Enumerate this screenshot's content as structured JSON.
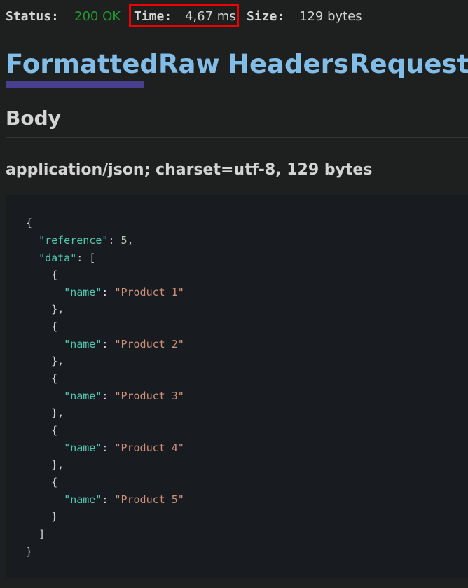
{
  "status_bar": {
    "status_label": "Status:",
    "status_value": "200 OK",
    "time_label": "Time:",
    "time_value": "4,67 ms",
    "size_label": "Size:",
    "size_value": "129 bytes"
  },
  "tabs": [
    {
      "label": "Formatted",
      "active": true
    },
    {
      "label": "Raw",
      "active": false
    },
    {
      "label": "Headers",
      "active": false
    },
    {
      "label": "Request",
      "active": false
    }
  ],
  "section": {
    "heading": "Body",
    "content_type": "application/json; charset=utf-8, 129 bytes"
  },
  "code": {
    "open_brace": "{",
    "reference_key": "\"reference\"",
    "reference_value": "5",
    "data_key": "\"data\"",
    "name_key": "\"name\"",
    "items": [
      "\"Product 1\"",
      "\"Product 2\"",
      "\"Product 3\"",
      "\"Product 4\"",
      "\"Product 5\""
    ],
    "close_bracket": "]",
    "close_brace": "}"
  },
  "colors": {
    "accent_tab": "#82bde8",
    "tab_underline": "#483f8f",
    "status_ok": "#1f9d2e",
    "highlight_box": "#f00000",
    "json_key": "#4ec9b0",
    "json_string": "#ce9178",
    "json_number": "#b5cea8"
  }
}
